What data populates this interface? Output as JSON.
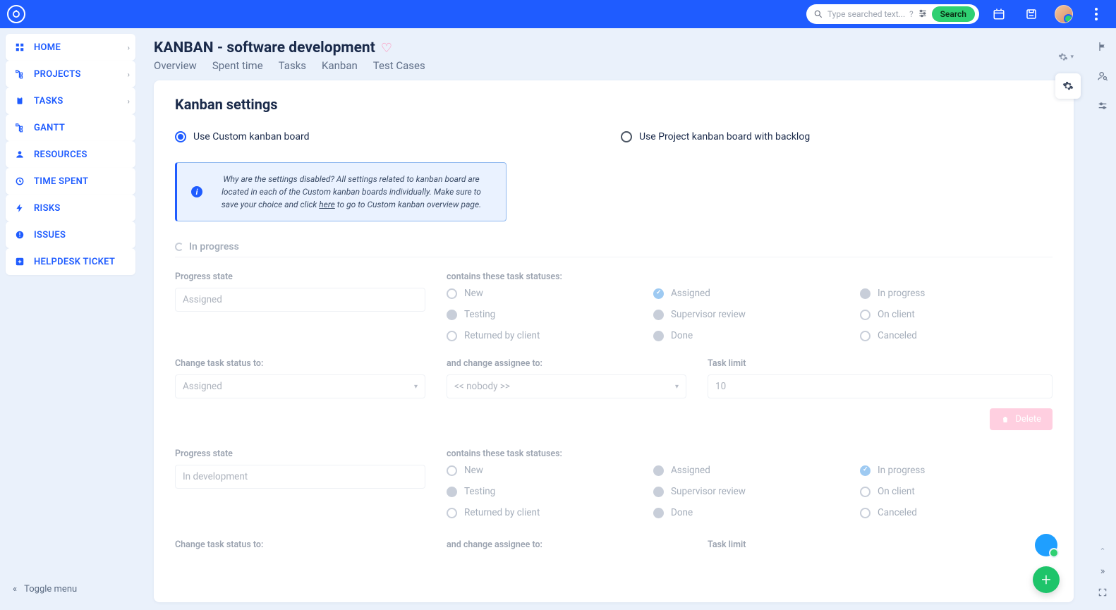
{
  "topbar": {
    "search_placeholder": "Type searched text...",
    "search_button": "Search"
  },
  "sidebar": {
    "items": [
      {
        "label": "HOME",
        "icon": "grid",
        "chevron": true
      },
      {
        "label": "PROJECTS",
        "icon": "tree",
        "chevron": true
      },
      {
        "label": "TASKS",
        "icon": "clipboard",
        "chevron": true
      },
      {
        "label": "GANTT",
        "icon": "tree",
        "chevron": false
      },
      {
        "label": "RESOURCES",
        "icon": "person",
        "chevron": false
      },
      {
        "label": "TIME SPENT",
        "icon": "clock",
        "chevron": false
      },
      {
        "label": "RISKS",
        "icon": "bolt",
        "chevron": false
      },
      {
        "label": "ISSUES",
        "icon": "alert",
        "chevron": false
      },
      {
        "label": "HELPDESK TICKET",
        "icon": "plus-box",
        "chevron": false
      }
    ],
    "toggle": "Toggle menu"
  },
  "page": {
    "title": "KANBAN - software development",
    "tabs": [
      "Overview",
      "Spent time",
      "Tasks",
      "Kanban",
      "Test Cases"
    ],
    "card_title": "Kanban settings",
    "radio_custom": "Use Custom kanban board",
    "radio_project": "Use Project kanban board with backlog",
    "info_part1": "Why are the settings disabled? All settings related to kanban board are located in each of the Custom kanban boards individually. Make sure to save your choice and click ",
    "info_link": "here",
    "info_part2": " to go to Custom kanban overview page.",
    "section": "In progress",
    "labels": {
      "progress_state": "Progress state",
      "contains": "contains these task statuses:",
      "change_status": "Change task status to:",
      "change_assignee": "and change assignee to:",
      "task_limit": "Task limit"
    },
    "states": [
      {
        "name": "Assigned",
        "statuses": [
          {
            "label": "New",
            "type": "radio"
          },
          {
            "label": "Assigned",
            "type": "checked"
          },
          {
            "label": "In progress",
            "type": "filled"
          },
          {
            "label": "Testing",
            "type": "filled"
          },
          {
            "label": "Supervisor review",
            "type": "filled"
          },
          {
            "label": "On client",
            "type": "radio"
          },
          {
            "label": "Returned by client",
            "type": "radio"
          },
          {
            "label": "Done",
            "type": "filled"
          },
          {
            "label": "Canceled",
            "type": "radio"
          }
        ],
        "change_status": "Assigned",
        "change_assignee": "<< nobody >>",
        "task_limit": "10"
      },
      {
        "name": "In development",
        "statuses": [
          {
            "label": "New",
            "type": "radio"
          },
          {
            "label": "Assigned",
            "type": "filled"
          },
          {
            "label": "In progress",
            "type": "checked"
          },
          {
            "label": "Testing",
            "type": "filled"
          },
          {
            "label": "Supervisor review",
            "type": "filled"
          },
          {
            "label": "On client",
            "type": "radio"
          },
          {
            "label": "Returned by client",
            "type": "radio"
          },
          {
            "label": "Done",
            "type": "filled"
          },
          {
            "label": "Canceled",
            "type": "radio"
          }
        ]
      }
    ],
    "delete": "Delete"
  }
}
